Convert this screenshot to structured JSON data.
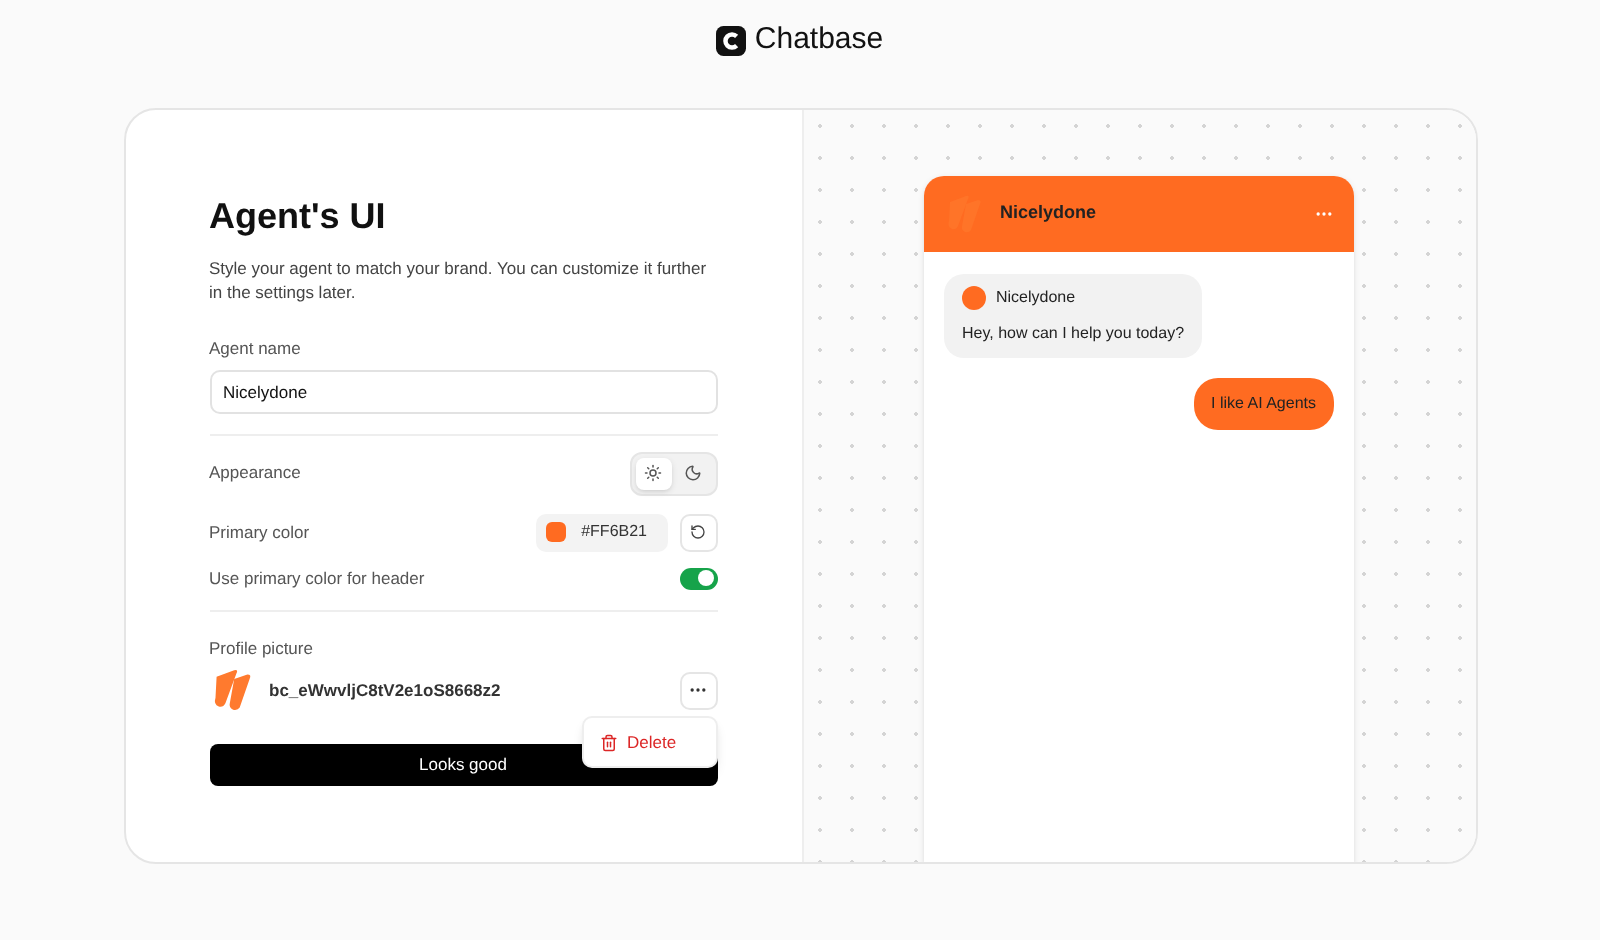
{
  "brand": {
    "name": "Chatbase"
  },
  "form": {
    "title": "Agent's UI",
    "description": "Style your agent to match your brand. You can customize it further in the settings later.",
    "agent_name": {
      "label": "Agent name",
      "value": "Nicelydone"
    },
    "appearance": {
      "label": "Appearance",
      "options": [
        {
          "kind": "light",
          "selected": true
        },
        {
          "kind": "dark",
          "selected": false
        }
      ]
    },
    "primary_color": {
      "label": "Primary color",
      "value": "#FF6B21",
      "color": "#ff6b21"
    },
    "header_color": {
      "label": "Use primary color for header",
      "on": true
    },
    "profile_picture": {
      "label": "Profile picture",
      "file": "bc_eWwvljC8tV2e1oS8668z2",
      "menu": [
        {
          "label": "Delete"
        }
      ]
    },
    "submit": "Looks good"
  },
  "preview": {
    "agent_name": "Nicelydone",
    "messages": [
      {
        "kind": "bot",
        "sender": "Nicelydone",
        "text": "Hey, how can I help you today?"
      },
      {
        "kind": "user",
        "text": "I like AI Agents"
      }
    ]
  }
}
